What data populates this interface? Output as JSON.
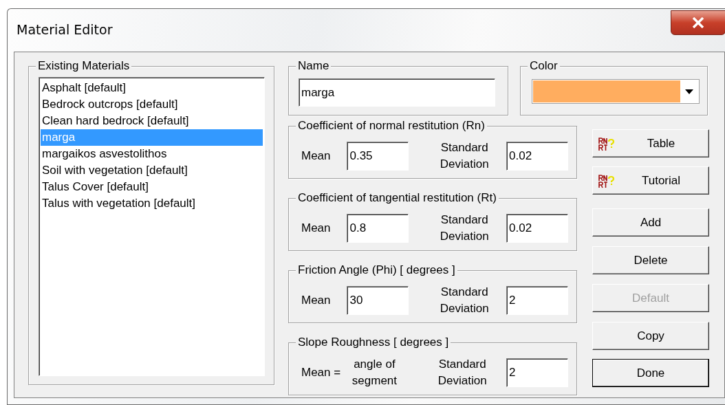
{
  "window": {
    "title": "Material Editor"
  },
  "materials": {
    "title": "Existing Materials",
    "items": [
      {
        "label": "Asphalt [default]",
        "selected": false
      },
      {
        "label": "Bedrock outcrops [default]",
        "selected": false
      },
      {
        "label": "Clean hard bedrock [default]",
        "selected": false
      },
      {
        "label": "marga",
        "selected": true
      },
      {
        "label": "margaikos asvestolithos",
        "selected": false
      },
      {
        "label": "Soil with vegetation [default]",
        "selected": false
      },
      {
        "label": "Talus Cover [default]",
        "selected": false
      },
      {
        "label": "Talus with vegetation [default]",
        "selected": false
      }
    ]
  },
  "name": {
    "title": "Name",
    "value": "marga"
  },
  "color": {
    "title": "Color",
    "color": "#ffad5f"
  },
  "parameters": [
    {
      "kind": "input",
      "title": "Coefficient of normal restitution (Rn)",
      "mean_label": "Mean",
      "mean_value": "0.35",
      "sd_label": "Standard Deviation",
      "sd_value": "0.02"
    },
    {
      "kind": "input",
      "title": "Coefficient of tangential restitution (Rt)",
      "mean_label": "Mean",
      "mean_value": "0.8",
      "sd_label": "Standard Deviation",
      "sd_value": "0.02"
    },
    {
      "kind": "input",
      "title": "Friction Angle (Phi) [ degrees ]",
      "mean_label": "Mean",
      "mean_value": "30",
      "sd_label": "Standard Deviation",
      "sd_value": "2"
    },
    {
      "kind": "text",
      "title": "Slope Roughness [ degrees ]",
      "mean_label": "Mean =",
      "mean_text": "angle of segment",
      "sd_label": "Standard Deviation",
      "sd_value": "2"
    }
  ],
  "buttons": [
    {
      "label": "Table",
      "kind": "help",
      "disabled": false,
      "default": false
    },
    {
      "label": "Tutorial",
      "kind": "help",
      "disabled": false,
      "default": false
    },
    {
      "label": "Add",
      "kind": "plain",
      "disabled": false,
      "default": false
    },
    {
      "label": "Delete",
      "kind": "plain",
      "disabled": false,
      "default": false
    },
    {
      "label": "Default",
      "kind": "plain",
      "disabled": true,
      "default": false
    },
    {
      "label": "Copy",
      "kind": "plain",
      "disabled": false,
      "default": false
    },
    {
      "label": "Done",
      "kind": "plain",
      "disabled": false,
      "default": true
    }
  ]
}
